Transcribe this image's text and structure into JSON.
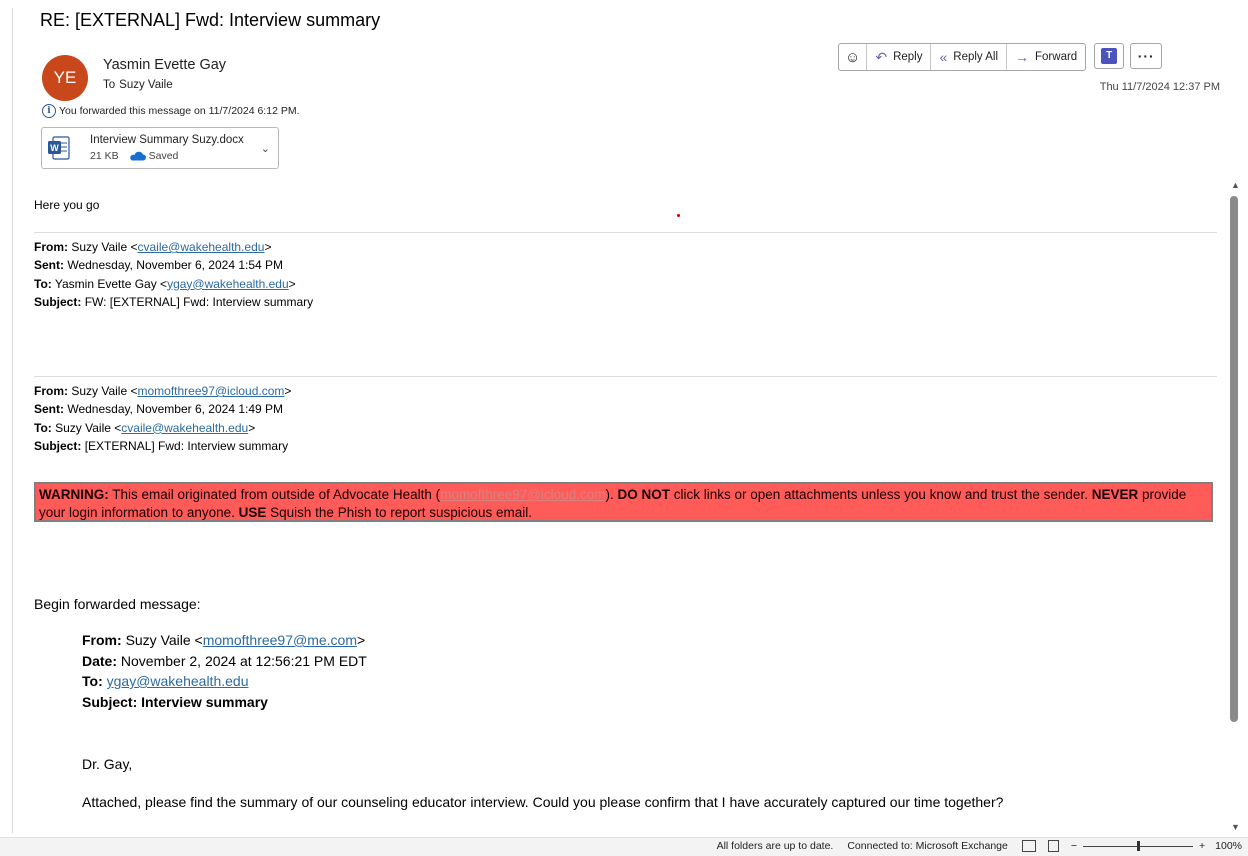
{
  "email": {
    "subject": "RE: [EXTERNAL] Fwd: Interview summary",
    "avatar_initials": "YE",
    "avatar_color": "#c8471b",
    "sender_name": "Yasmin Evette Gay",
    "to_label": "To",
    "to_name": "Suzy Vaile",
    "forward_notice": "You forwarded this message on 11/7/2024 6:12 PM.",
    "received": "Thu 11/7/2024 12:37 PM"
  },
  "attachment": {
    "icon": "word-doc-icon",
    "name": "Interview Summary Suzy.docx",
    "size": "21 KB",
    "status": "Saved"
  },
  "toolbar": {
    "emoji_icon": "☺",
    "reply_label": "Reply",
    "reply_all_label": "Reply All",
    "forward_label": "Forward",
    "teams_icon": "teams-icon",
    "more_label": "···"
  },
  "body": {
    "greeting": "Here you go",
    "msg1": {
      "from_label": "From:",
      "from_name": "Suzy Vaile <",
      "from_email": "cvaile@wakehealth.edu",
      "from_close": ">",
      "sent_label": "Sent:",
      "sent": "Wednesday, November 6, 2024 1:54 PM",
      "to_label": "To:",
      "to_name": "Yasmin Evette Gay <",
      "to_email": "ygay@wakehealth.edu",
      "to_close": ">",
      "subject_label": "Subject:",
      "subject": "FW: [EXTERNAL] Fwd: Interview summary"
    },
    "msg2": {
      "from_label": "From:",
      "from_name": "Suzy Vaile <",
      "from_email": "momofthree97@icloud.com",
      "from_close": ">",
      "sent_label": "Sent:",
      "sent": "Wednesday, November 6, 2024 1:49 PM",
      "to_label": "To:",
      "to_name": "Suzy Vaile <",
      "to_email": "cvaile@wakehealth.edu",
      "to_close": ">",
      "subject_label": "Subject:",
      "subject": "[EXTERNAL] Fwd: Interview summary"
    },
    "warning": {
      "label": "WARNING:",
      "text1": " This email originated from outside of Advocate Health (",
      "email": "momofthree97@icloud.com",
      "text2": "). ",
      "do_not": "DO NOT",
      "text3": " click links or open attachments unless you know and trust the sender. ",
      "never": "NEVER",
      "text4": " provide your login information to anyone. ",
      "use": "USE",
      "text5": " Squish the Phish to report suspicious email.",
      "bg_color": "#ff5b59"
    },
    "begin_forwarded": "Begin forwarded message:",
    "fwd": {
      "from_label": "From:",
      "from_name": "Suzy Vaile <",
      "from_email": "momofthree97@me.com",
      "from_close": ">",
      "date_label": "Date:",
      "date": "November 2, 2024 at 12:56:21 PM EDT",
      "to_label": "To:",
      "to_email": "ygay@wakehealth.edu",
      "subject_label": "Subject: Interview summary"
    },
    "salutation": "Dr. Gay,",
    "paragraph": "Attached, please find the summary of our counseling educator interview. Could you please confirm that I have accurately captured our time together?"
  },
  "statusbar": {
    "sync": "All folders are up to date.",
    "connection": "Connected to: Microsoft Exchange",
    "zoom_minus": "−",
    "zoom_plus": "+",
    "zoom": "100%"
  }
}
